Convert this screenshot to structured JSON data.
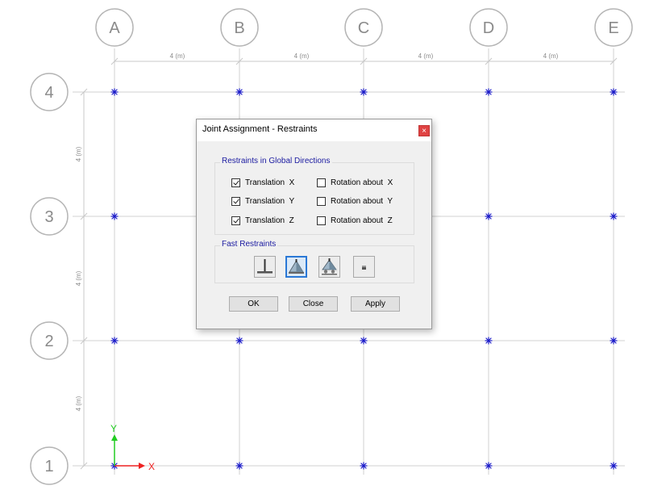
{
  "grid": {
    "columns": [
      "A",
      "B",
      "C",
      "D",
      "E"
    ],
    "rows": [
      "4",
      "3",
      "2",
      "1"
    ],
    "dimension_label": "4 (m)",
    "line_color": "#d0d0d0",
    "bubble_color": "#b5b5b5",
    "joint_color": "#1a1ac8"
  },
  "axes": {
    "x_label": "X",
    "y_label": "Y",
    "x_color": "#ee2222",
    "y_color": "#22cc22"
  },
  "dialog": {
    "title": "Joint Assignment - Restraints",
    "close_glyph": "×",
    "global_group": {
      "title": "Restraints in Global Directions",
      "translation_x": {
        "label": "Translation  X",
        "checked": true
      },
      "translation_y": {
        "label": "Translation  Y",
        "checked": true
      },
      "translation_z": {
        "label": "Translation  Z",
        "checked": true
      },
      "rotation_x": {
        "label": "Rotation about  X",
        "checked": false
      },
      "rotation_y": {
        "label": "Rotation about  Y",
        "checked": false
      },
      "rotation_z": {
        "label": "Rotation about  Z",
        "checked": false
      }
    },
    "fast_group": {
      "title": "Fast Restraints",
      "buttons": [
        {
          "icon": "fixed-support-icon",
          "selected": false
        },
        {
          "icon": "pinned-support-icon",
          "selected": true
        },
        {
          "icon": "roller-support-icon",
          "selected": false
        },
        {
          "icon": "free-joint-icon",
          "selected": false
        }
      ]
    },
    "ok_label": "OK",
    "close_label": "Close",
    "apply_label": "Apply"
  }
}
